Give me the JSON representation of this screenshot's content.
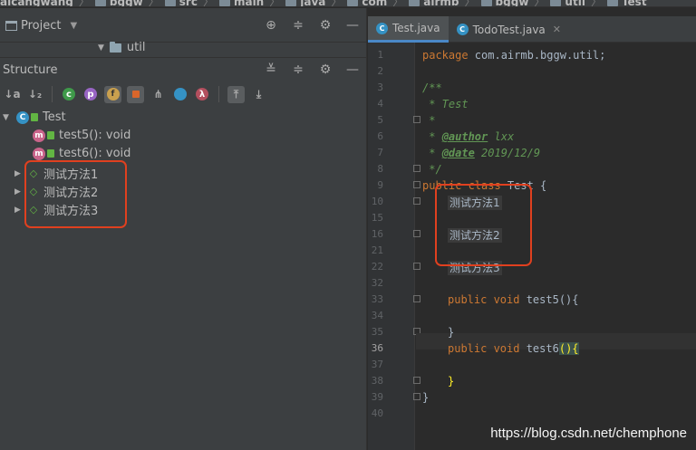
{
  "breadcrumbs": [
    "aicangwang",
    "bggw",
    "src",
    "main",
    "java",
    "com",
    "airmb",
    "bggw",
    "util",
    "Test"
  ],
  "project_panel": {
    "title": "Project",
    "folder": "util"
  },
  "structure_panel": {
    "title": "Structure",
    "toolbar_glyphs": [
      "↓a",
      "↓₂",
      "c",
      "p",
      "f",
      "🔒",
      "⋔",
      "●",
      "λ",
      "⤒",
      "⤓"
    ],
    "class_name": "Test",
    "methods": [
      "test5(): void",
      "test6(): void"
    ],
    "regions": [
      "测试方法1",
      "测试方法2",
      "测试方法3"
    ]
  },
  "editor": {
    "tabs": [
      {
        "label": "Test.java",
        "active": true
      },
      {
        "label": "TodoTest.java",
        "active": false
      }
    ],
    "line_numbers": [
      "1",
      "2",
      "3",
      "4",
      "5",
      "6",
      "7",
      "8",
      "9",
      "10",
      "15",
      "16",
      "21",
      "22",
      "32",
      "33",
      "34",
      "35",
      "36",
      "37",
      "38",
      "39",
      "40"
    ],
    "current_line": "36",
    "code": {
      "package_kw": "package",
      "package_name": " com.airmb.bggw.util;",
      "doc_open": "/**",
      "doc_title": " * Test",
      "doc_star": " *",
      "author_tag": "@author",
      "author_val": " lxx",
      "date_tag": "@date",
      "date_val": " 2019/12/9",
      "doc_close": " */",
      "class_kw": "public class",
      "class_name": " Test {",
      "region1": "测试方法1",
      "region2": "测试方法2",
      "region3": "测试方法3",
      "m5_kw": "public void",
      "m5_name": " test5(){",
      "close_brace": "}",
      "m6_kw": "public void",
      "m6_name": " test6",
      "m6_parens": "(){",
      "final_brace": "}"
    }
  },
  "watermark": "https://blog.csdn.net/chemphone",
  "colors": {
    "highlight_box": "#e0401f",
    "keyword": "#cc7832",
    "comment": "#629755"
  }
}
